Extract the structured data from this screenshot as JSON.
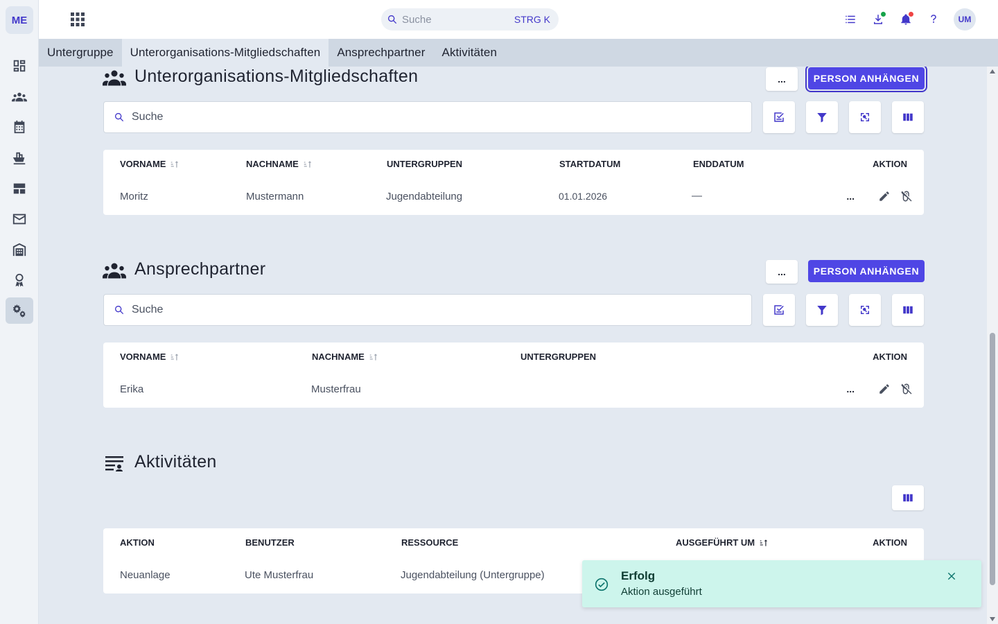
{
  "app": {
    "logo": "ME",
    "avatar": "UM"
  },
  "search": {
    "placeholder": "Suche",
    "shortcut": "STRG K"
  },
  "sidebar": {
    "items": [
      {
        "icon": "dashboard-icon"
      },
      {
        "icon": "people-icon"
      },
      {
        "icon": "calendar-icon"
      },
      {
        "icon": "ship-icon"
      },
      {
        "icon": "table-icon"
      },
      {
        "icon": "mail-icon"
      },
      {
        "icon": "warehouse-icon"
      },
      {
        "icon": "award-icon"
      },
      {
        "icon": "settings-icon",
        "active": true
      }
    ]
  },
  "tabs": [
    {
      "label": "Untergruppe"
    },
    {
      "label": "Unterorganisations-Mitgliedschaften",
      "active": true
    },
    {
      "label": "Ansprechpartner"
    },
    {
      "label": "Aktivitäten"
    }
  ],
  "sections": {
    "memberships": {
      "title": "Unterorganisations-Mitgliedschaften",
      "more": "...",
      "attach": "PERSON ANHÄNGEN",
      "search": "Suche",
      "columns": [
        "VORNAME",
        "NACHNAME",
        "UNTERGRUPPEN",
        "STARTDATUM",
        "ENDDATUM",
        "AKTION"
      ],
      "rows": [
        {
          "vorname": "Moritz",
          "nachname": "Mustermann",
          "untergruppen": "Jugendabteilung",
          "start": "01.01.2026",
          "end": "—",
          "more": "..."
        }
      ]
    },
    "contacts": {
      "title": "Ansprechpartner",
      "more": "...",
      "attach": "PERSON ANHÄNGEN",
      "search": "Suche",
      "columns": [
        "VORNAME",
        "NACHNAME",
        "UNTERGRUPPEN",
        "AKTION"
      ],
      "rows": [
        {
          "vorname": "Erika",
          "nachname": "Musterfrau",
          "untergruppen": "",
          "more": "..."
        }
      ]
    },
    "activities": {
      "title": "Aktivitäten",
      "columns": [
        "AKTION",
        "BENUTZER",
        "RESSOURCE",
        "AUSGEFÜHRT UM",
        "AKTION"
      ],
      "rows": [
        {
          "aktion": "Neuanlage",
          "benutzer": "Ute Musterfrau",
          "ressource": "Jugendabteilung (Untergruppe)"
        }
      ]
    }
  },
  "toast": {
    "title": "Erfolg",
    "message": "Aktion ausgeführt"
  },
  "colors": {
    "accent": "#4f46e5",
    "toast_bg": "#cdf5ec"
  }
}
